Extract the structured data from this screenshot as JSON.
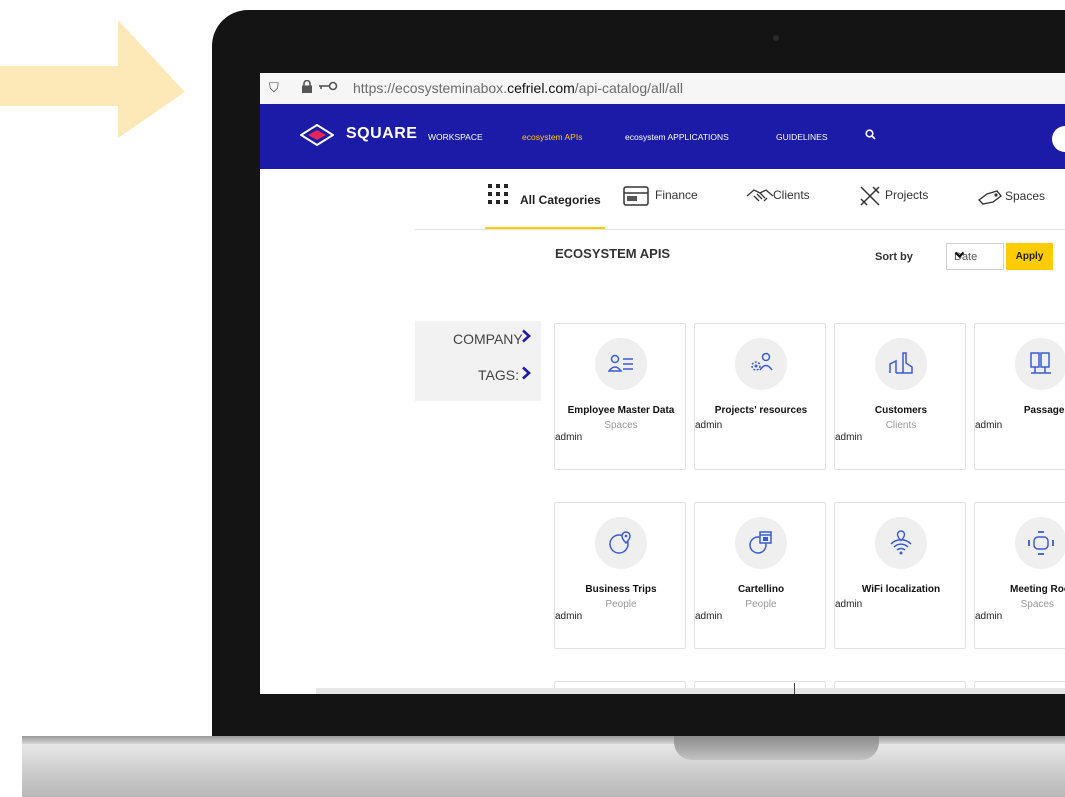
{
  "browser": {
    "url_prefix": "https://ecosysteminabox.",
    "url_domain": "cefriel.com",
    "url_path": "/api-catalog/all/all"
  },
  "header": {
    "brand": "SQUARE",
    "nav": [
      {
        "label": "WORKSPACE",
        "active": false
      },
      {
        "label": "ecosystem APIs",
        "active": true
      },
      {
        "label": "ecosystem APPLICATIONS",
        "active": false
      },
      {
        "label": "GUIDELINES",
        "active": false
      }
    ]
  },
  "categories": [
    {
      "label": "All Categories",
      "icon": "grid-icon",
      "selected": true
    },
    {
      "label": "Finance",
      "icon": "wallet-icon"
    },
    {
      "label": "Clients",
      "icon": "handshake-icon"
    },
    {
      "label": "Projects",
      "icon": "tools-icon"
    },
    {
      "label": "Spaces",
      "icon": "key-icon"
    }
  ],
  "main": {
    "title": "ECOSYSTEM APIS",
    "sort_label": "Sort by",
    "sort_value": "Date",
    "apply_label": "Apply"
  },
  "filters": [
    {
      "label": "COMPANY"
    },
    {
      "label": "TAGS:"
    }
  ],
  "cards": [
    {
      "title": "Employee Master Data",
      "category": "Spaces",
      "owner": "admin",
      "icon": "person-list-icon"
    },
    {
      "title": "Projects' resources",
      "category": "",
      "owner": "admin",
      "icon": "gear-people-icon"
    },
    {
      "title": "Customers",
      "category": "Clients",
      "owner": "admin",
      "icon": "factory-icon"
    },
    {
      "title": "Passages",
      "category": "",
      "owner": "admin",
      "icon": "doors-icon"
    },
    {
      "title": "Business Trips",
      "category": "People",
      "owner": "admin",
      "icon": "globe-pin-icon"
    },
    {
      "title": "Cartellino",
      "category": "People",
      "owner": "admin",
      "icon": "calendar-icon"
    },
    {
      "title": "WiFi localization",
      "category": "",
      "owner": "admin",
      "icon": "wifi-pin-icon"
    },
    {
      "title": "Meeting Roo",
      "category": "Spaces",
      "owner": "admin",
      "icon": "meeting-table-icon"
    }
  ],
  "colors": {
    "nav_bg": "#1b1ba8",
    "accent": "#ffcc00",
    "arrow": "#fde9b8"
  }
}
